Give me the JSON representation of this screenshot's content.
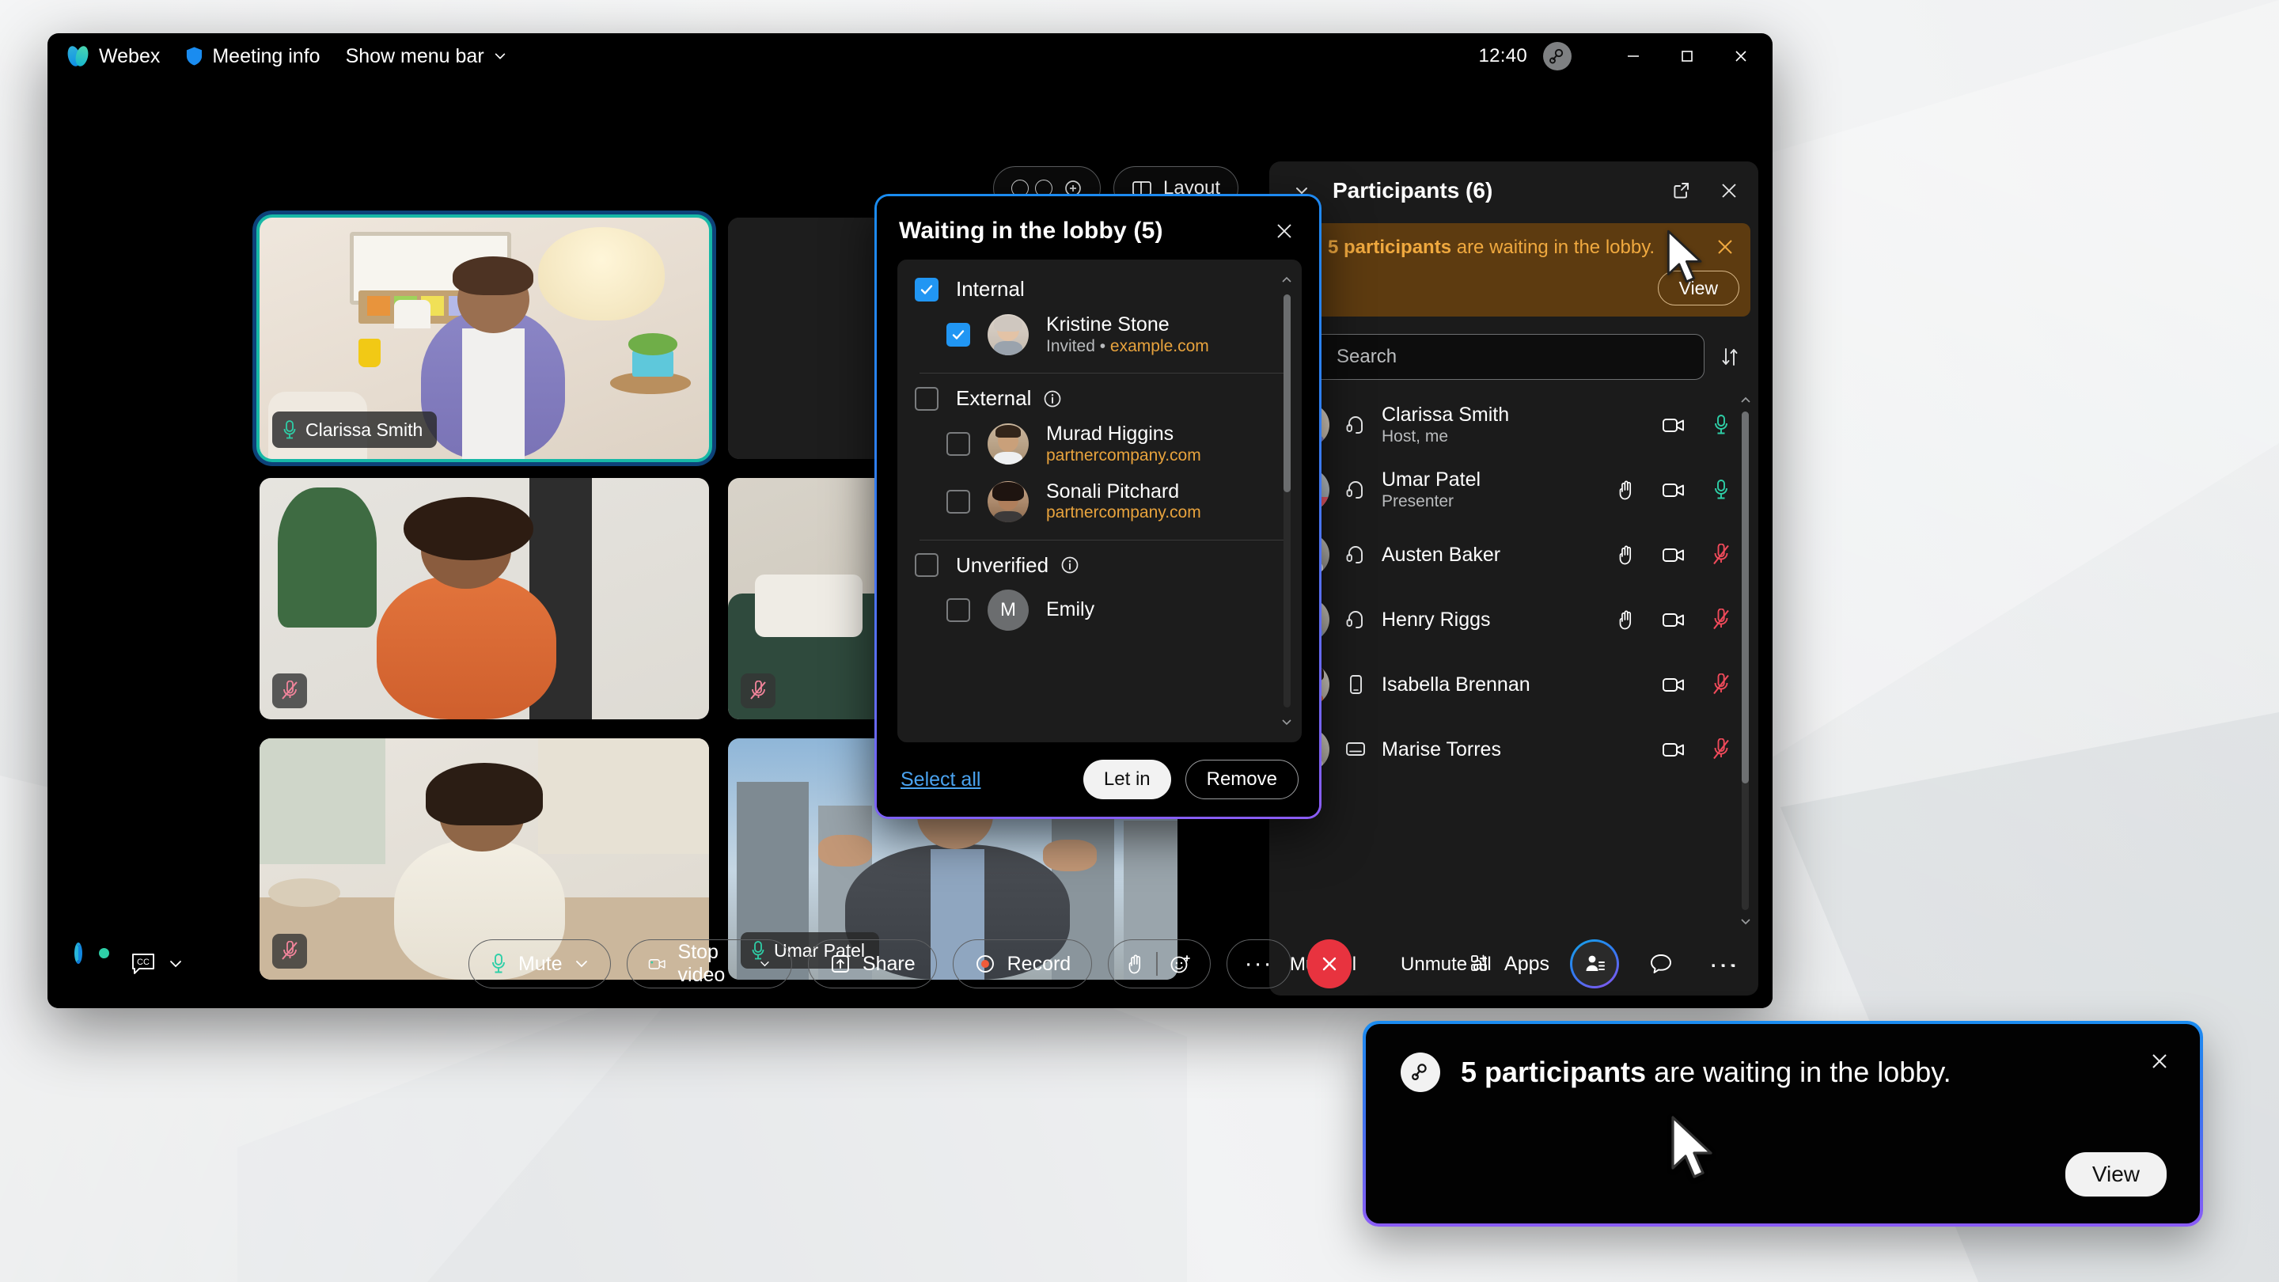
{
  "window": {
    "titlebar": {
      "app_name": "Webex",
      "meeting_info": "Meeting info",
      "show_menu_bar": "Show menu bar",
      "clock": "12:40",
      "minimize": "Minimize",
      "maximize": "Maximize",
      "close": "Close"
    },
    "top_controls": {
      "layout_label": "Layout"
    }
  },
  "stage": {
    "tiles": [
      {
        "name": "Clarissa Smith",
        "label_visible": true,
        "muted": false,
        "active_speaker": true
      },
      {
        "name": "",
        "label_visible": false,
        "muted": false,
        "active_speaker": false
      },
      {
        "name": "",
        "label_visible": false,
        "muted": true,
        "active_speaker": false
      },
      {
        "name": "",
        "label_visible": false,
        "muted": true,
        "active_speaker": false
      },
      {
        "name": "",
        "label_visible": false,
        "muted": true,
        "active_speaker": false
      },
      {
        "name": "Umar Patel",
        "label_visible": true,
        "muted": false,
        "active_speaker": false
      }
    ]
  },
  "lobby_dialog": {
    "title": "Waiting in the lobby (5)",
    "close_label": "Close",
    "groups": [
      {
        "label": "Internal",
        "checked": true,
        "has_info": false,
        "people": [
          {
            "name": "Kristine Stone",
            "status": "Invited",
            "separator": "•",
            "domain": "example.com",
            "checked": true,
            "avatar_type": "photo"
          }
        ]
      },
      {
        "label": "External",
        "checked": false,
        "has_info": true,
        "people": [
          {
            "name": "Murad Higgins",
            "status": "",
            "separator": "",
            "domain": "partnercompany.com",
            "checked": false,
            "avatar_type": "photo"
          },
          {
            "name": "Sonali Pitchard",
            "status": "",
            "separator": "",
            "domain": "partnercompany.com",
            "checked": false,
            "avatar_type": "photo"
          }
        ]
      },
      {
        "label": "Unverified",
        "checked": false,
        "has_info": true,
        "people": [
          {
            "name": "Emily",
            "status": "",
            "separator": "",
            "domain": "",
            "checked": false,
            "avatar_type": "initial",
            "initial": "M"
          }
        ]
      }
    ],
    "select_all": "Select all",
    "let_in": "Let in",
    "remove": "Remove"
  },
  "participants_panel": {
    "title": "Participants (6)",
    "collapse_label": "Collapse",
    "popout_label": "Open in new window",
    "close_label": "Close",
    "banner": {
      "count_text": "5 participants",
      "rest_text": " are waiting in the lobby.",
      "view_label": "View",
      "dismiss_label": "Dismiss"
    },
    "search_placeholder": "Search",
    "sort_label": "Sort",
    "people": [
      {
        "name": "Clarissa Smith",
        "role": "Host, me",
        "device": "headset",
        "hand_raised": false,
        "video_on": true,
        "mic": "on"
      },
      {
        "name": "Umar Patel",
        "role": "Presenter",
        "device": "headset",
        "hand_raised": true,
        "video_on": true,
        "mic": "on",
        "sharing_badge": true
      },
      {
        "name": "Austen Baker",
        "role": "",
        "device": "headset",
        "hand_raised": true,
        "video_on": true,
        "mic": "muted"
      },
      {
        "name": "Henry Riggs",
        "role": "",
        "device": "headset",
        "hand_raised": true,
        "video_on": true,
        "mic": "muted"
      },
      {
        "name": "Isabella Brennan",
        "role": "",
        "device": "mobile",
        "hand_raised": false,
        "video_on": true,
        "mic": "muted"
      },
      {
        "name": "Marise Torres",
        "role": "",
        "device": "device",
        "hand_raised": false,
        "video_on": true,
        "mic": "muted"
      }
    ],
    "footer": {
      "mute_all": "Mute all",
      "unmute_all": "Unmute all",
      "more": "···"
    }
  },
  "toolbar": {
    "captions_label": "CC",
    "mute": "Mute",
    "stop_video": "Stop video",
    "share": "Share",
    "record": "Record",
    "more": "···",
    "end_label": "Leave meeting",
    "apps": "Apps",
    "participants_label": "Participants",
    "chat_label": "Chat",
    "more_right": "···"
  },
  "toast": {
    "count_text": "5 participants",
    "rest_text": " are waiting in the lobby.",
    "view_label": "View",
    "close_label": "Close"
  },
  "colors": {
    "accent_blue": "#1a8cf0",
    "accent_purple": "#8b5cf6",
    "banner_amber": "#f0a93f",
    "banner_bg": "#5d3b10",
    "mic_green": "#2ecfa7",
    "mic_muted_red": "#ef4a5a",
    "end_red": "#e8333f",
    "active_speaker": "#17b8a6"
  }
}
